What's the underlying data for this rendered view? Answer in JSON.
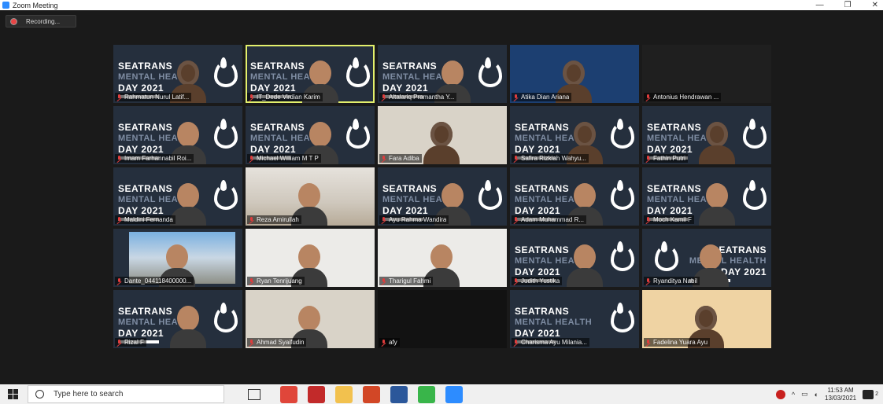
{
  "window": {
    "title": "Zoom Meeting",
    "minimize": "—",
    "restore": "❐",
    "close": "✕"
  },
  "recording": {
    "label": "Recording..."
  },
  "banner": {
    "line1": "SEATRANS",
    "line2": "MENTAL HEALTH",
    "line3": "DAY 2021"
  },
  "participants": [
    {
      "name": "Rahmatun Nurul Latif...",
      "theme": "banner",
      "avatar": "hijab",
      "active": false
    },
    {
      "name": "IT_Dede Virdian Karim",
      "theme": "banner",
      "avatar": "person",
      "active": true
    },
    {
      "name": "Altalariq Pramantha Y...",
      "theme": "banner",
      "avatar": "person",
      "active": false
    },
    {
      "name": "Atika Dian Ariana",
      "theme": "blue",
      "avatar": "hijab",
      "active": false
    },
    {
      "name": "Antonius Hendrawan ...",
      "theme": "empty",
      "avatar": "none",
      "active": false
    },
    {
      "name": "Imam Farhannabil Roi...",
      "theme": "banner",
      "avatar": "person",
      "active": false
    },
    {
      "name": "Michael William M T P",
      "theme": "banner",
      "avatar": "person",
      "active": false
    },
    {
      "name": "Fara Adiba",
      "theme": "light",
      "avatar": "hijab",
      "active": false
    },
    {
      "name": "Safira Rizkiah Wahyu...",
      "theme": "banner",
      "avatar": "hijab",
      "active": false
    },
    {
      "name": "Fathin Putri",
      "theme": "banner",
      "avatar": "hijab",
      "active": false
    },
    {
      "name": "Maldini Fernanda",
      "theme": "banner",
      "avatar": "person",
      "active": false
    },
    {
      "name": "Reza Amirullah",
      "theme": "room",
      "avatar": "person",
      "active": false
    },
    {
      "name": "Ayu Rahma Wandira",
      "theme": "banner",
      "avatar": "person",
      "active": false
    },
    {
      "name": "Adam Muhammad R...",
      "theme": "banner",
      "avatar": "person",
      "active": false
    },
    {
      "name": "Moch Kamil F",
      "theme": "banner",
      "avatar": "person",
      "active": false
    },
    {
      "name": "Dante_044118400000...",
      "theme": "window",
      "avatar": "person",
      "active": false
    },
    {
      "name": "Ryan Tenrijuang",
      "theme": "plain",
      "avatar": "person",
      "active": false
    },
    {
      "name": "Tharigul Fahmi",
      "theme": "plain",
      "avatar": "person",
      "active": false
    },
    {
      "name": "Judith Yustika",
      "theme": "banner",
      "avatar": "person",
      "active": false
    },
    {
      "name": "Ryanditya Nabil",
      "theme": "banner-mirror",
      "avatar": "person",
      "active": false
    },
    {
      "name": "Rizal F",
      "theme": "banner",
      "avatar": "person",
      "active": false
    },
    {
      "name": "Ahmad Syaifudin",
      "theme": "light",
      "avatar": "person",
      "active": false
    },
    {
      "name": "afy",
      "theme": "dark",
      "avatar": "none",
      "active": false
    },
    {
      "name": "Charisma Ayu Milania...",
      "theme": "banner",
      "avatar": "none",
      "active": false
    },
    {
      "name": "Fadelina Yuara Ayu",
      "theme": "warm",
      "avatar": "hijab",
      "active": false
    }
  ],
  "taskbar": {
    "search_placeholder": "Type here to search",
    "start_icon": "windows-start-icon",
    "apps": [
      {
        "name": "task-view",
        "color": "#333333"
      },
      {
        "name": "chrome",
        "color": "#e0463a"
      },
      {
        "name": "video-app",
        "color": "#c22a2a"
      },
      {
        "name": "file-explorer",
        "color": "#f2c14e"
      },
      {
        "name": "powerpoint",
        "color": "#d24726"
      },
      {
        "name": "word",
        "color": "#2b579a"
      },
      {
        "name": "line",
        "color": "#39b54a"
      },
      {
        "name": "zoom",
        "color": "#2d8cff"
      }
    ],
    "time": "11:53 AM",
    "date": "13/03/2021",
    "notification_count": "2"
  }
}
